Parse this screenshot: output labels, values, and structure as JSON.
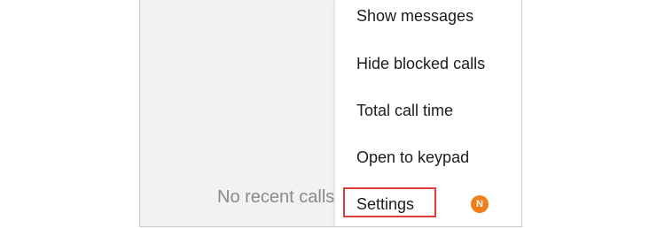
{
  "call_log": {
    "empty_message": "No recent calls"
  },
  "overflow_menu": {
    "items": [
      {
        "label": "Show messages"
      },
      {
        "label": "Hide blocked calls"
      },
      {
        "label": "Total call time"
      },
      {
        "label": "Open to keypad"
      },
      {
        "label": "Settings"
      }
    ],
    "settings_badge": "N",
    "highlight_color": "#e03c3c",
    "badge_color": "#f07f1b"
  }
}
